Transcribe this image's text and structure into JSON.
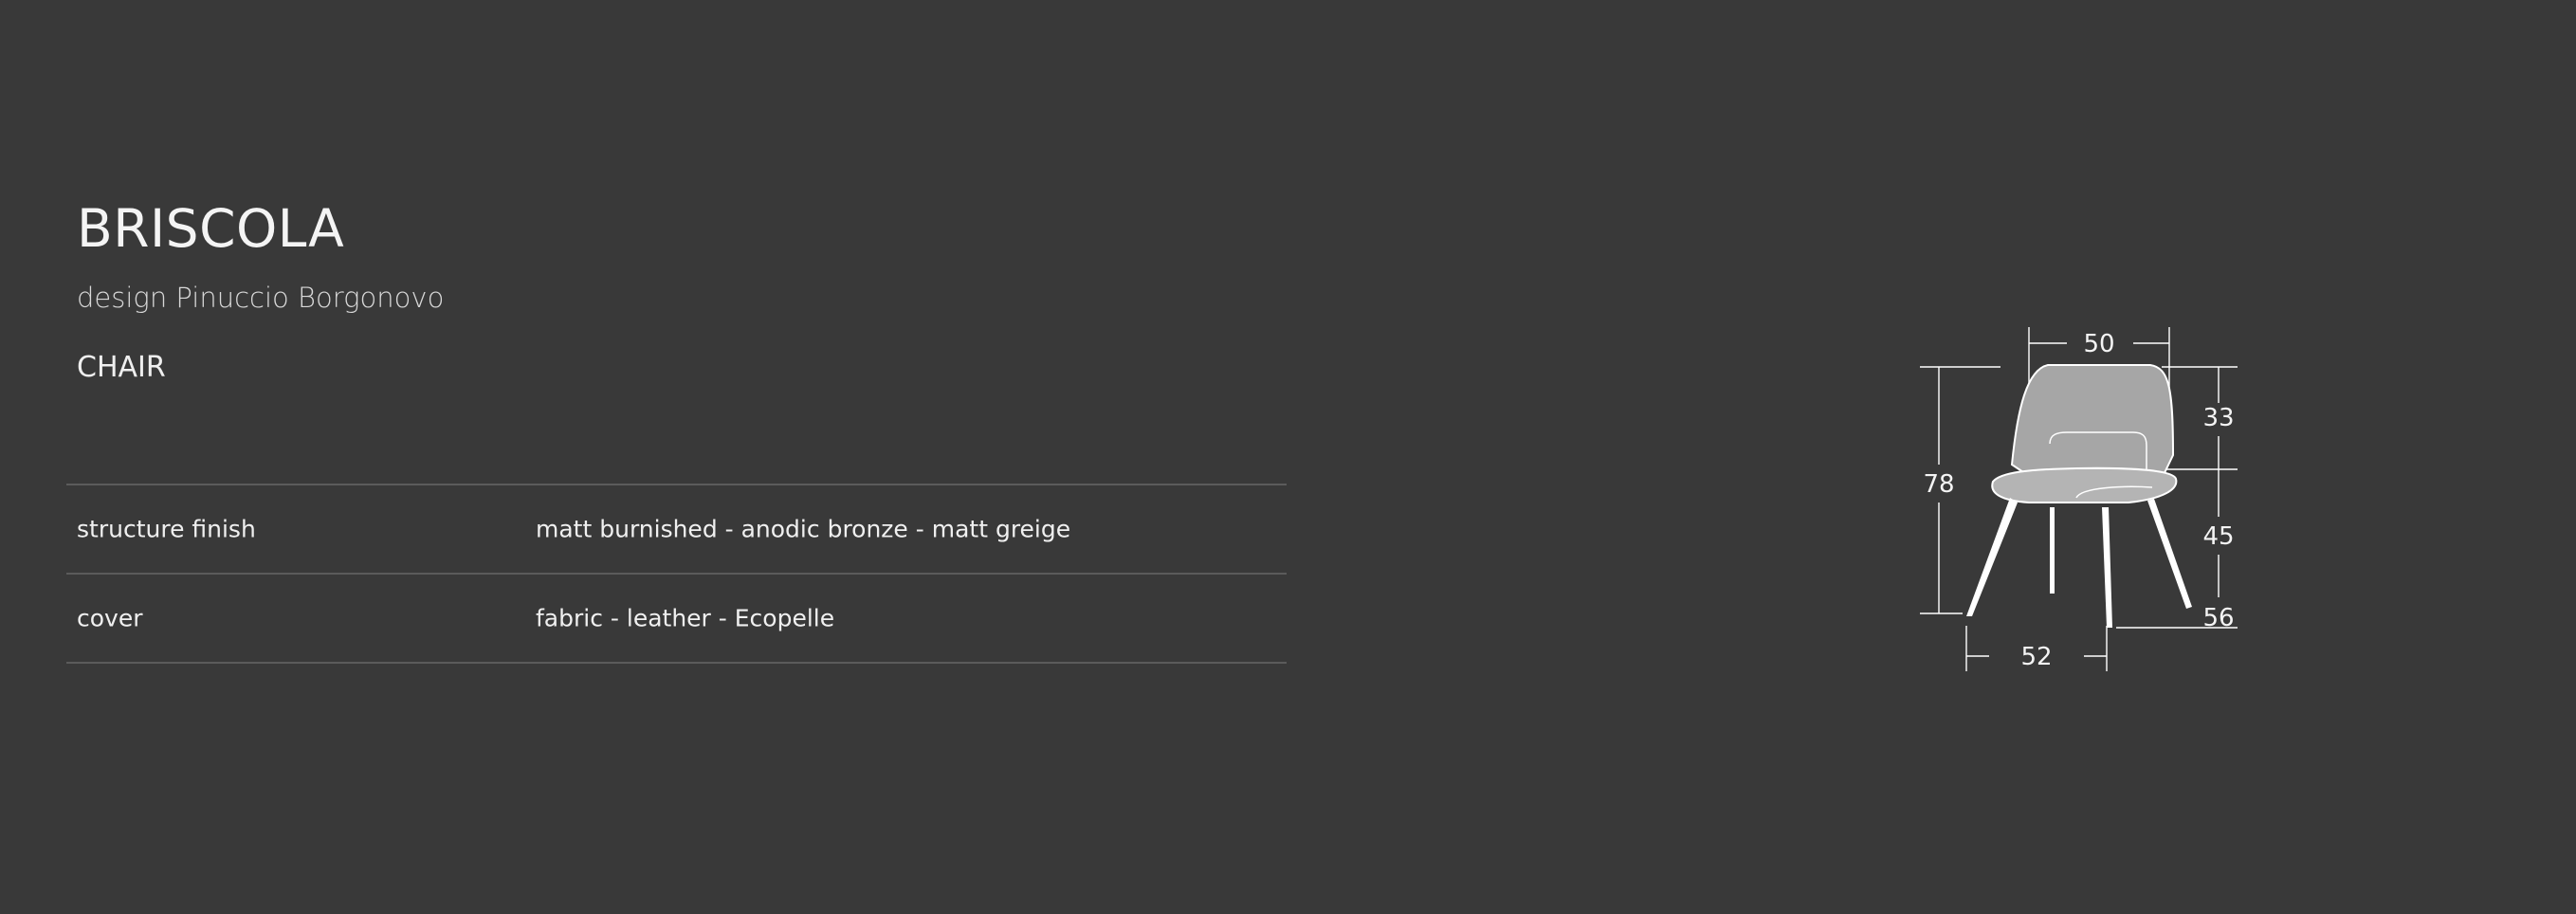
{
  "product": {
    "name": "BRISCOLA",
    "designer": "design Pinuccio Borgonovo",
    "category": "CHAIR"
  },
  "specs": [
    {
      "label": "structure finish",
      "value": "matt burnished - anodic bronze - matt greige"
    },
    {
      "label": "cover",
      "value": "fabric - leather - Ecopelle"
    }
  ],
  "dimensions": {
    "top_width": "50",
    "back_height": "33",
    "total_height": "78",
    "seat_height": "45",
    "depth": "56",
    "width": "52"
  },
  "colors": {
    "background": "#393939",
    "text": "#f2f2f2",
    "rule": "#5b5b5b",
    "drawing": "#ffffff"
  }
}
